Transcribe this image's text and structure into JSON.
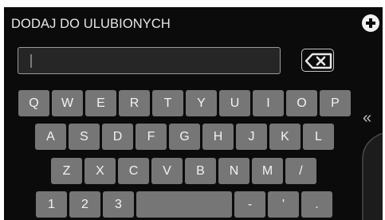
{
  "title": "DODAJ DO ULUBIONYCH",
  "input": {
    "value": ""
  },
  "icons": {
    "add": "plus-circle-icon",
    "backspace": "backspace-x-icon",
    "side": "double-chevron-left-icon"
  },
  "side_chevron": "«",
  "keyboard": {
    "row1": [
      "Q",
      "W",
      "E",
      "R",
      "T",
      "Y",
      "U",
      "I",
      "O",
      "P"
    ],
    "row2": [
      "A",
      "S",
      "D",
      "F",
      "G",
      "H",
      "J",
      "K",
      "L"
    ],
    "row3": [
      "Z",
      "X",
      "C",
      "V",
      "B",
      "N",
      "M",
      "/"
    ],
    "row4": [
      "1",
      "2",
      "3",
      " ",
      "-",
      "'",
      "."
    ]
  },
  "colors": {
    "background": "#0b0b0b",
    "key": "#767676",
    "text": "#f2f2f2"
  }
}
